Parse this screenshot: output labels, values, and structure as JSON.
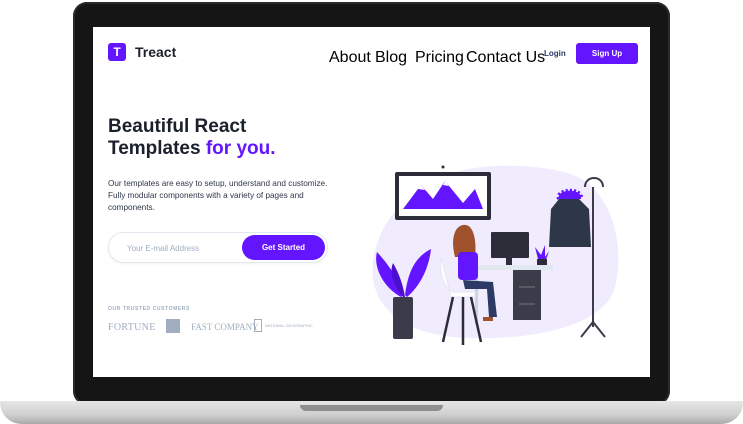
{
  "brand": {
    "logo_letter": "T",
    "name": "Treact"
  },
  "nav": {
    "links": [
      "About",
      "Blog",
      "Pricing",
      "Contact Us"
    ],
    "login_label": "Login",
    "signup_label": "Sign Up"
  },
  "hero": {
    "headline_line1": "Beautiful React",
    "headline_line2_plain": "Templates ",
    "headline_line2_accent": "for you.",
    "subtext": "Our templates are easy to setup, understand and customize. Fully modular components with a variety of pages and components.",
    "email_placeholder": "Your E-mail Address",
    "cta_label": "Get Started"
  },
  "customers": {
    "heading": "OUR TRUSTED CUSTOMERS",
    "logos": [
      "FORTUNE",
      "FAST COMPANY",
      "NATIONAL GEOGRAPHIC"
    ]
  },
  "colors": {
    "accent": "#6415ff",
    "text": "#1a202c",
    "muted": "#a0aec0"
  }
}
